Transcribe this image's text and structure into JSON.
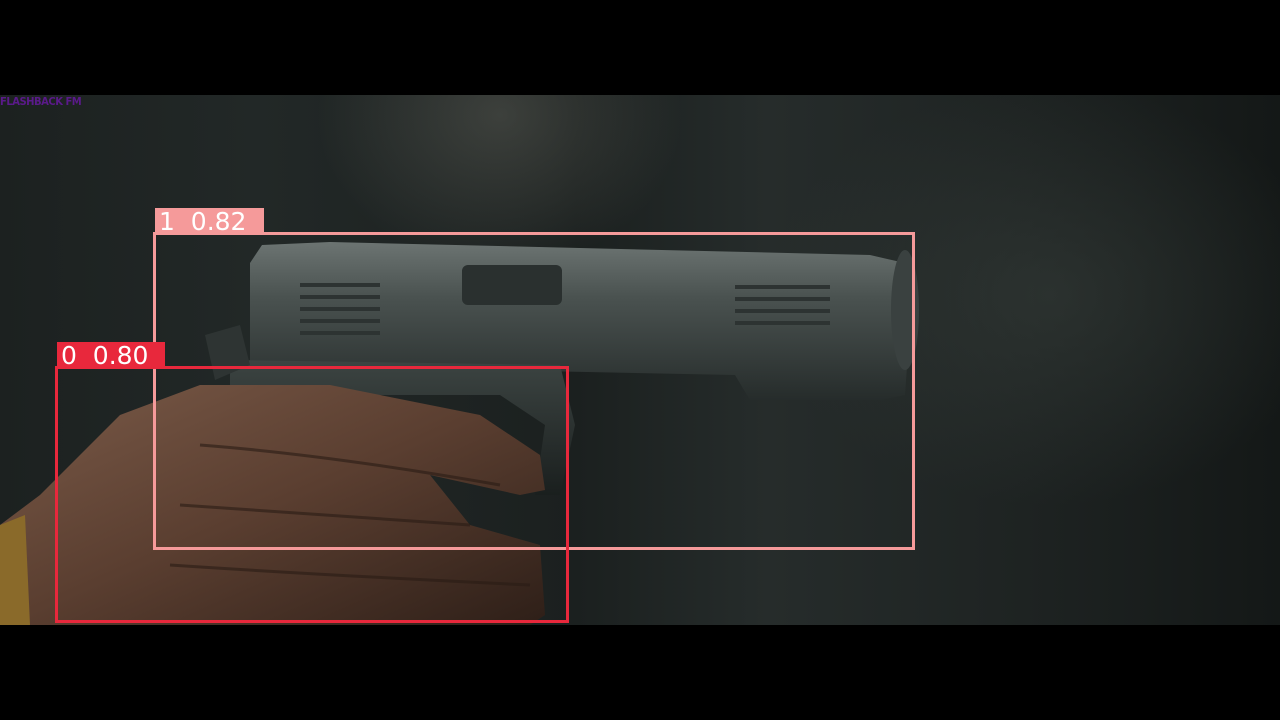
{
  "scene": {
    "description_free": true,
    "background_color": "#000000"
  },
  "watermark": {
    "text": "FLASHBACK FM"
  },
  "detections": [
    {
      "class_id": "1",
      "confidence": "0.82",
      "label": "1  0.82",
      "color": "#f59a9a"
    },
    {
      "class_id": "0",
      "confidence": "0.80",
      "label": "0  0.80",
      "color": "#e8283c"
    }
  ]
}
